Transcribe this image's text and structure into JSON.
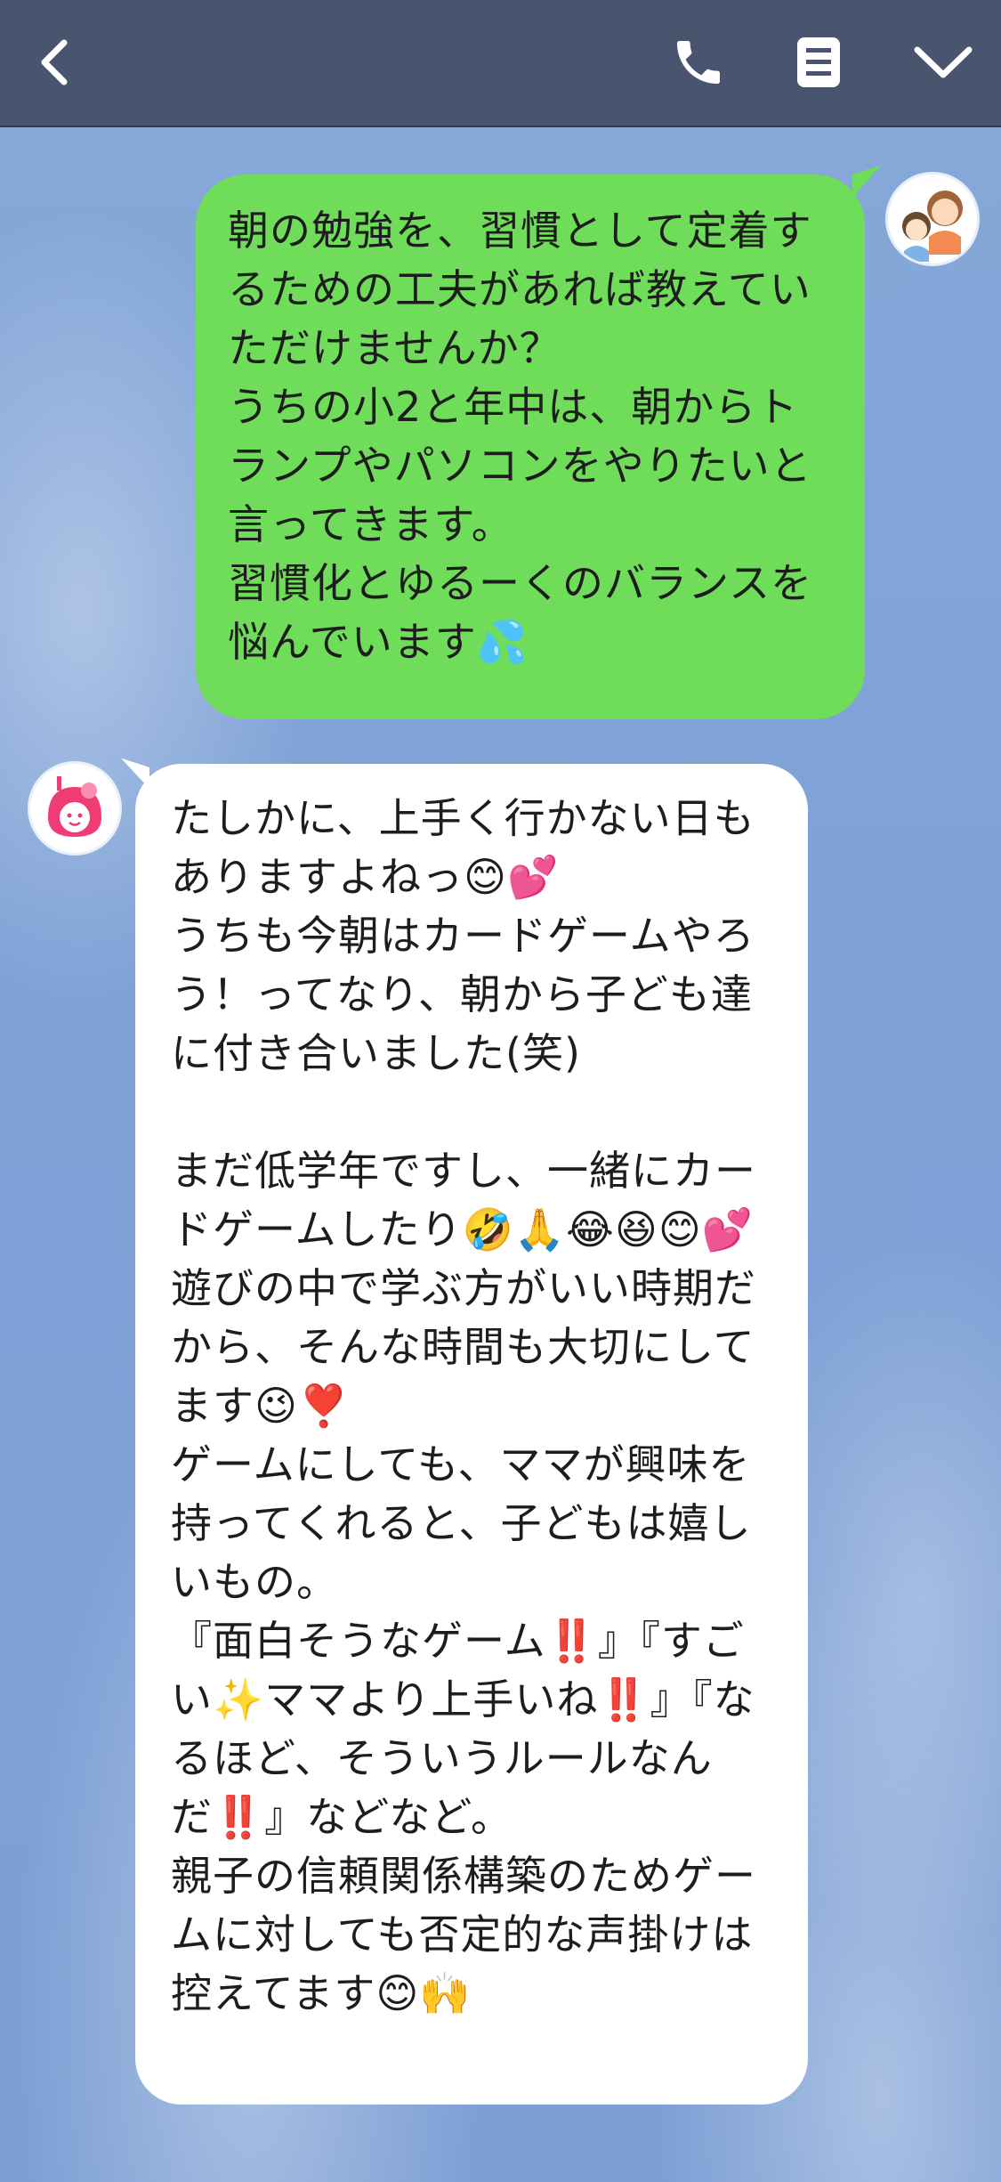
{
  "app": {
    "title": "",
    "icons": {
      "back": "chevron-left-icon",
      "call": "phone-icon",
      "notes": "notes-icon",
      "menu": "chevron-down-icon"
    },
    "colors": {
      "topbar": "#49546e",
      "outgoing_bubble": "#6fdc5a",
      "incoming_bubble": "#ffffff",
      "background": "#7fa3d6"
    }
  },
  "messages": [
    {
      "sender": "me",
      "avatar": "mother-and-child-avatar",
      "text": "朝の勉強を、習慣として定着するための工夫があれば教えていただけませんか？\nうちの小2と年中は、朝からトランプやパソコンをやりたいと言ってきます。\n習慣化とゆるーくのバランスを悩んでいます💦"
    },
    {
      "sender": "other",
      "avatar": "pink-mom-icon-avatar",
      "text": "たしかに、上手く行かない日もありますよねっ😊💕\nうちも今朝はカードゲームやろう！ってなり、朝から子ども達に付き合いました(笑)\n\nまだ低学年ですし、一緒にカードゲームしたり🤣🙏😂😆😊💕\n遊びの中で学ぶ方がいい時期だから、そんな時間も大切にしてます😉❣️\nゲームにしても、ママが興味を持ってくれると、子どもは嬉しいもの。\n『面白そうなゲーム‼️』『すごい✨ママより上手いね‼️』『なるほど、そういうルールなんだ‼️』などなど。\n親子の信頼関係構築のためゲームに対しても否定的な声掛けは控えてます😊🙌"
    }
  ]
}
